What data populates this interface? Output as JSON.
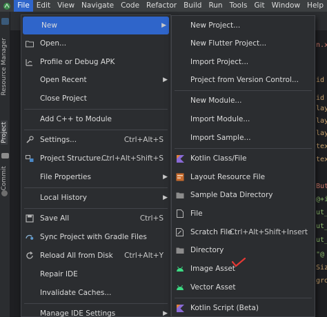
{
  "menubar": {
    "items": [
      "File",
      "Edit",
      "View",
      "Navigate",
      "Code",
      "Refactor",
      "Build",
      "Run",
      "Tools",
      "Git",
      "Window",
      "Help"
    ]
  },
  "left_strip": {
    "resource_manager": "Resource Manager",
    "project": "Project",
    "commit": "Commit"
  },
  "file_menu": {
    "items": [
      {
        "label": "New",
        "icon": "none",
        "arrow": true,
        "active": true
      },
      {
        "label": "Open...",
        "icon": "folder-icon"
      },
      {
        "label": "Profile or Debug APK",
        "icon": "apk-icon"
      },
      {
        "label": "Open Recent",
        "icon": "none",
        "arrow": true
      },
      {
        "label": "Close Project",
        "icon": "none"
      },
      {
        "label": "Add C++ to Module",
        "icon": "none"
      },
      {
        "label": "Settings...",
        "icon": "wrench-icon",
        "shortcut": "Ctrl+Alt+S"
      },
      {
        "label": "Project Structure...",
        "icon": "project-structure-icon",
        "shortcut": "Ctrl+Alt+Shift+S"
      },
      {
        "label": "File Properties",
        "icon": "none",
        "arrow": true
      },
      {
        "label": "Local History",
        "icon": "none",
        "arrow": true
      },
      {
        "label": "Save All",
        "icon": "save-icon",
        "shortcut": "Ctrl+S"
      },
      {
        "label": "Sync Project with Gradle Files",
        "icon": "gradle-sync-icon"
      },
      {
        "label": "Reload All from Disk",
        "icon": "reload-icon",
        "shortcut": "Ctrl+Alt+Y"
      },
      {
        "label": "Repair IDE",
        "icon": "none"
      },
      {
        "label": "Invalidate Caches...",
        "icon": "none"
      },
      {
        "label": "Manage IDE Settings",
        "icon": "none",
        "arrow": true
      }
    ]
  },
  "new_submenu": {
    "items": [
      {
        "label": "New Project...",
        "icon": "none"
      },
      {
        "label": "New Flutter Project...",
        "icon": "none"
      },
      {
        "label": "Import Project...",
        "icon": "none"
      },
      {
        "label": "Project from Version Control...",
        "icon": "none"
      },
      {
        "label": "New Module...",
        "icon": "none"
      },
      {
        "label": "Import Module...",
        "icon": "none"
      },
      {
        "label": "Import Sample...",
        "icon": "none"
      },
      {
        "label": "Kotlin Class/File",
        "icon": "kotlin-icon"
      },
      {
        "label": "Layout Resource File",
        "icon": "layout-icon"
      },
      {
        "label": "Sample Data Directory",
        "icon": "folder-icon"
      },
      {
        "label": "File",
        "icon": "file-icon"
      },
      {
        "label": "Scratch File",
        "icon": "scratch-icon",
        "shortcut": "Ctrl+Alt+Shift+Insert"
      },
      {
        "label": "Directory",
        "icon": "folder-icon"
      },
      {
        "label": "Image Asset",
        "icon": "android-icon"
      },
      {
        "label": "Vector Asset",
        "icon": "android-icon"
      },
      {
        "label": "Kotlin Script (Beta)",
        "icon": "kotlin-icon"
      }
    ]
  },
  "editor_fragments": [
    "n.x",
    "id",
    "id",
    "lay",
    "lay",
    "lay",
    "tex",
    "tex",
    "Butt",
    "@+i",
    "ut_",
    "ut_",
    "ut_",
    "\"@",
    "Siz",
    "gro"
  ],
  "colors": {
    "accent": "#2f65ca",
    "menu_bg": "#2b2d30",
    "android_green": "#3ddc84",
    "check_red": "#e53935"
  }
}
